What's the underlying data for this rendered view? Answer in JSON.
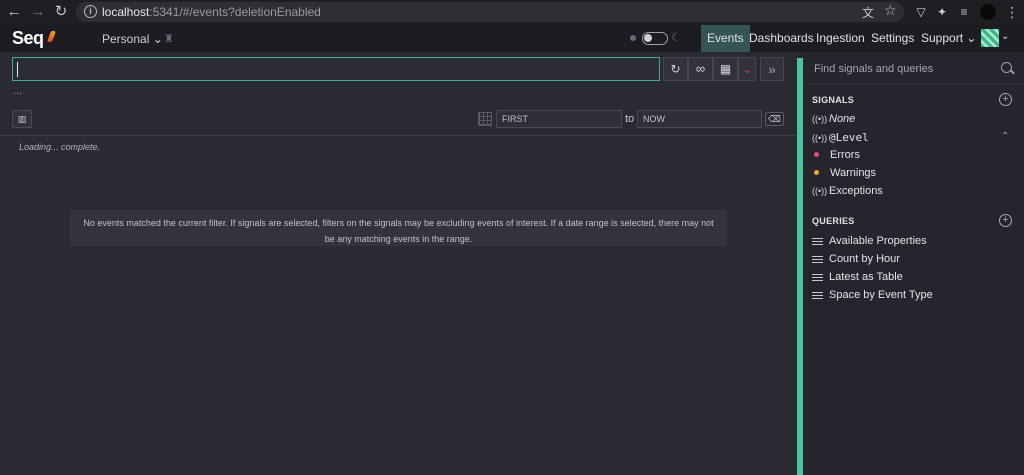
{
  "browser": {
    "url_host": "localhost",
    "url_rest": ":5341/#/events?deletionEnabled",
    "back": "←",
    "forward": "→",
    "reload": "↻",
    "info": "i",
    "translate": "文",
    "star": "☆",
    "ext_icons": [
      "▽",
      "✦",
      "≡",
      "▢"
    ],
    "menu": "⋮"
  },
  "header": {
    "logo": "Seq",
    "workspace": "Personal",
    "workspace_chevron": "⌄",
    "nav": [
      "Events",
      "Dashboards",
      "Ingestion",
      "Settings",
      "Support"
    ],
    "support_chevron": "⌄",
    "active_nav": "Events",
    "moon": "☾"
  },
  "toolbar": {
    "refresh": "↻",
    "link": "∞",
    "view": "▦",
    "dropdown": "⌄",
    "expand": "»",
    "ellipsis": "...",
    "histogram": "▥",
    "range_from": "FIRST",
    "range_to_label": "to",
    "range_to": "NOW",
    "clear": "⌫"
  },
  "main": {
    "status": "Loading... complete.",
    "empty_message": "No events matched the current filter. If signals are selected, filters on the signals may be excluding events of interest. If a date range is selected, there may not be any matching events in the range."
  },
  "sidebar": {
    "search_placeholder": "Find signals and queries",
    "signals_title": "SIGNALS",
    "signals": [
      {
        "label": "None",
        "icon": "((•))",
        "style": "italic"
      },
      {
        "label": "@Level",
        "icon": "((•))",
        "style": "mono"
      },
      {
        "label": "Errors",
        "dot_color": "#e0506c"
      },
      {
        "label": "Warnings",
        "dot_color": "#f0a830"
      },
      {
        "label": "Exceptions",
        "icon": "((•))"
      }
    ],
    "level_chevron": "⌃",
    "queries_title": "QUERIES",
    "queries": [
      "Available Properties",
      "Count by Hour",
      "Latest as Table",
      "Space by Event Type"
    ],
    "add": "+"
  }
}
